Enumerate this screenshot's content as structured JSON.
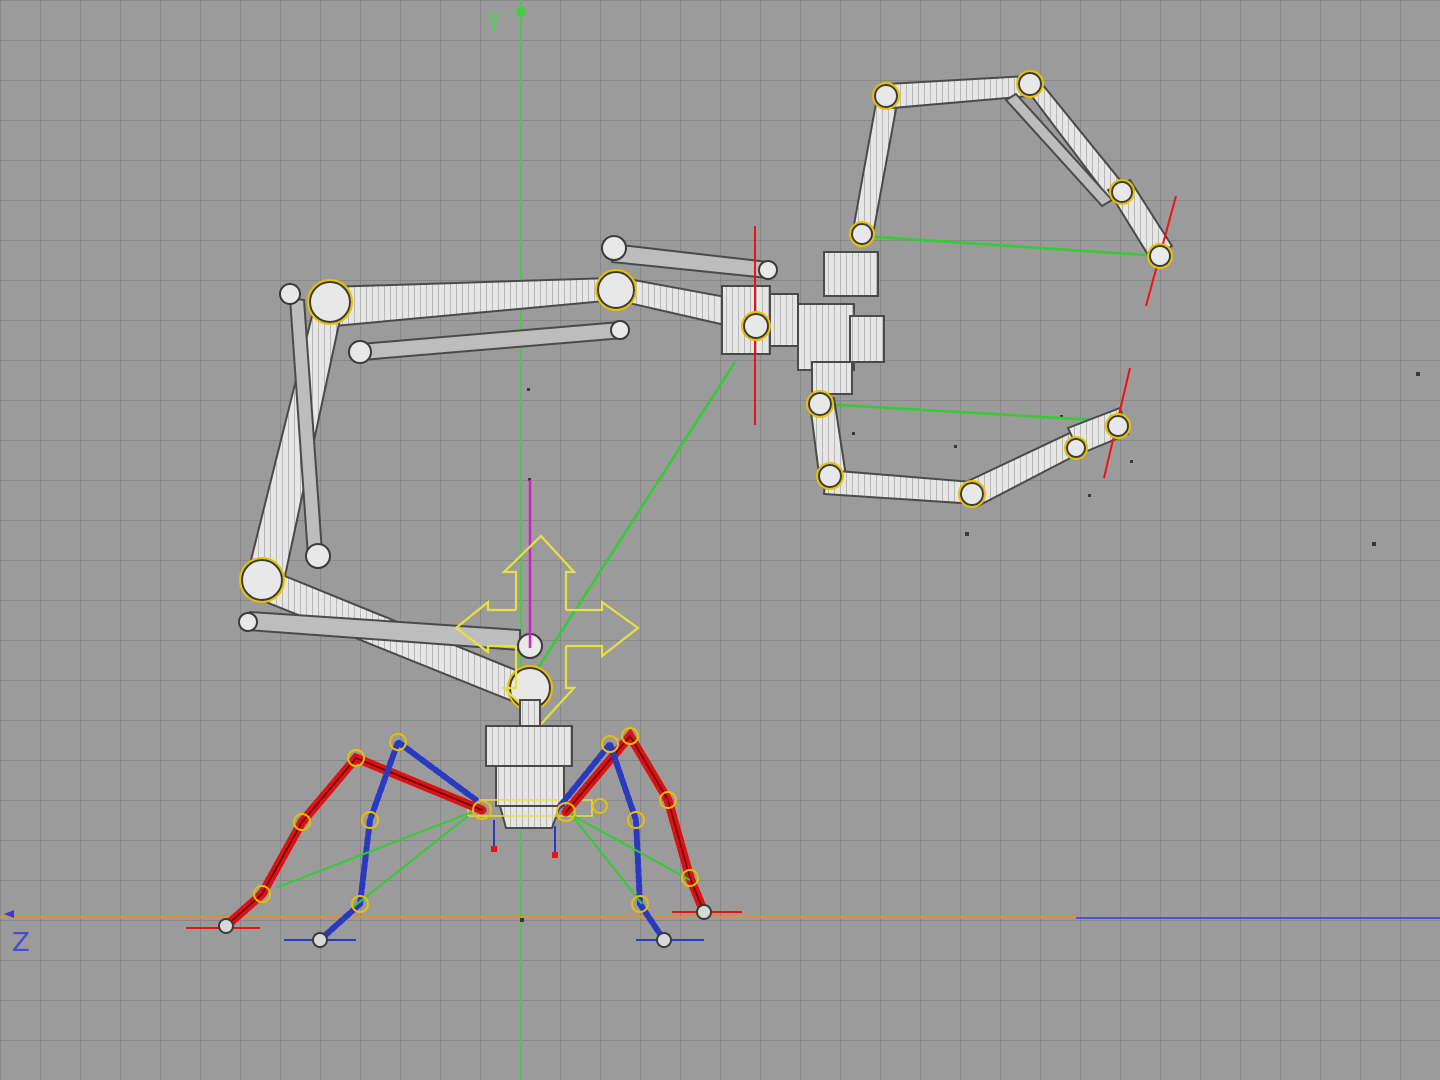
{
  "viewport": {
    "axis_y_label": "Y",
    "axis_z_label": "Z"
  },
  "colors": {
    "background": "#9b9b9b",
    "grid": "#7f7f7f",
    "y_axis": "#44cc44",
    "z_axis": "#3a3ad8",
    "ground_line": "#e09030",
    "bone_fill": "#ececec",
    "bone_edge": "#4a4a4a",
    "joint_highlight": "#e8c000",
    "ik_link": "#33cc33",
    "ik_goal": "#ee1111",
    "leg_red": "#dd1111",
    "leg_blue": "#2a3ac0",
    "gizmo": "#e8e040",
    "up_vector": "#cc22cc"
  },
  "icons": {
    "move_gizmo": "move-arrows-icon",
    "joint": "joint-circle-icon"
  }
}
